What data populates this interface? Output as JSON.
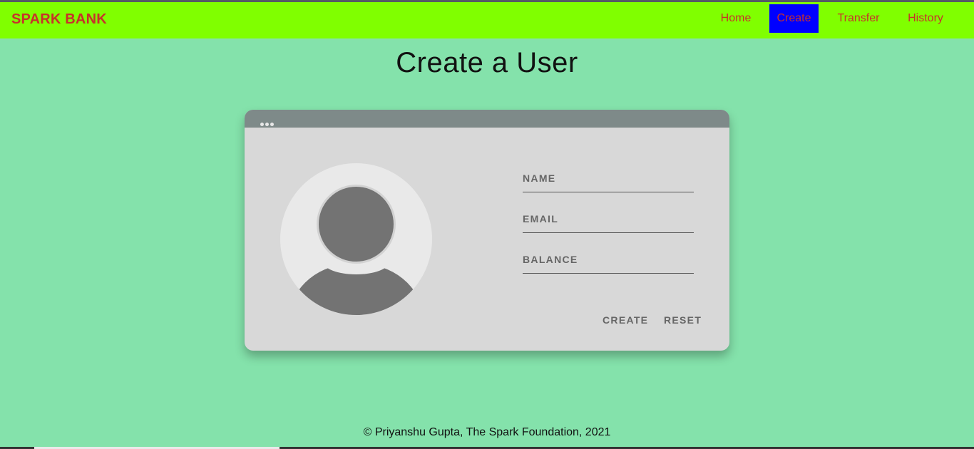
{
  "navbar": {
    "brand": "SPARK BANK",
    "items": [
      {
        "label": "Home",
        "active": false
      },
      {
        "label": "Create",
        "active": true
      },
      {
        "label": "Transfer",
        "active": false
      },
      {
        "label": "History",
        "active": false
      }
    ]
  },
  "page": {
    "title": "Create a User"
  },
  "form": {
    "name_placeholder": "NAME",
    "email_placeholder": "EMAIL",
    "balance_placeholder": "BALANCE",
    "create_label": "CREATE",
    "reset_label": "RESET"
  },
  "footer": {
    "text": "© Priyanshu Gupta, The Spark Foundation, 2021"
  },
  "colors": {
    "background": "#84e2ab",
    "navbar": "#80ff00",
    "nav_text": "#c8322a",
    "active_tab": "#0000ff",
    "card": "#d8d8d8",
    "card_bar": "#7e8a89"
  },
  "icons": {
    "avatar": "user-avatar-icon",
    "window_dots": "more-dots-icon"
  }
}
